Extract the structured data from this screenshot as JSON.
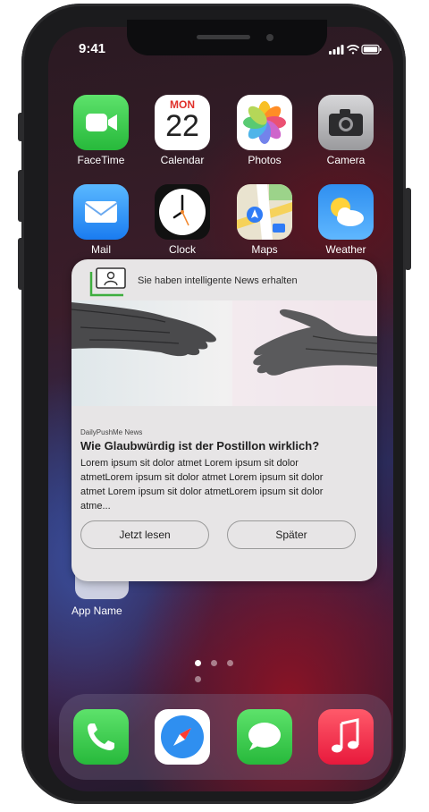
{
  "status_bar": {
    "time": "9:41"
  },
  "apps": [
    {
      "name": "FaceTime",
      "icon": "facetime-icon"
    },
    {
      "name": "Calendar",
      "icon": "calendar-icon",
      "weekday": "MON",
      "day": "22"
    },
    {
      "name": "Photos",
      "icon": "photos-icon"
    },
    {
      "name": "Camera",
      "icon": "camera-icon"
    },
    {
      "name": "Mail",
      "icon": "mail-icon"
    },
    {
      "name": "Clock",
      "icon": "clock-icon"
    },
    {
      "name": "Maps",
      "icon": "maps-icon"
    },
    {
      "name": "Weather",
      "icon": "weather-icon"
    }
  ],
  "notification": {
    "header": "Sie haben intelligente News erhalten",
    "source": "DailyPushMe News",
    "title": "Wie Glaubwürdig ist der Postillon wirklich?",
    "body": "Lorem ipsum sit dolor atmet Lorem ipsum sit dolor atmetLorem ipsum sit dolor atmet Lorem ipsum sit dolor atmet Lorem ipsum sit dolor atmetLorem ipsum sit dolor atme...",
    "primary_button": "Jetzt lesen",
    "secondary_button": "Später"
  },
  "app_under_notification": {
    "label": "App Name"
  },
  "page_dots": {
    "count": 4,
    "active": 0
  },
  "dock": [
    {
      "icon": "phone-icon"
    },
    {
      "icon": "safari-icon"
    },
    {
      "icon": "messages-icon"
    },
    {
      "icon": "music-icon"
    }
  ]
}
